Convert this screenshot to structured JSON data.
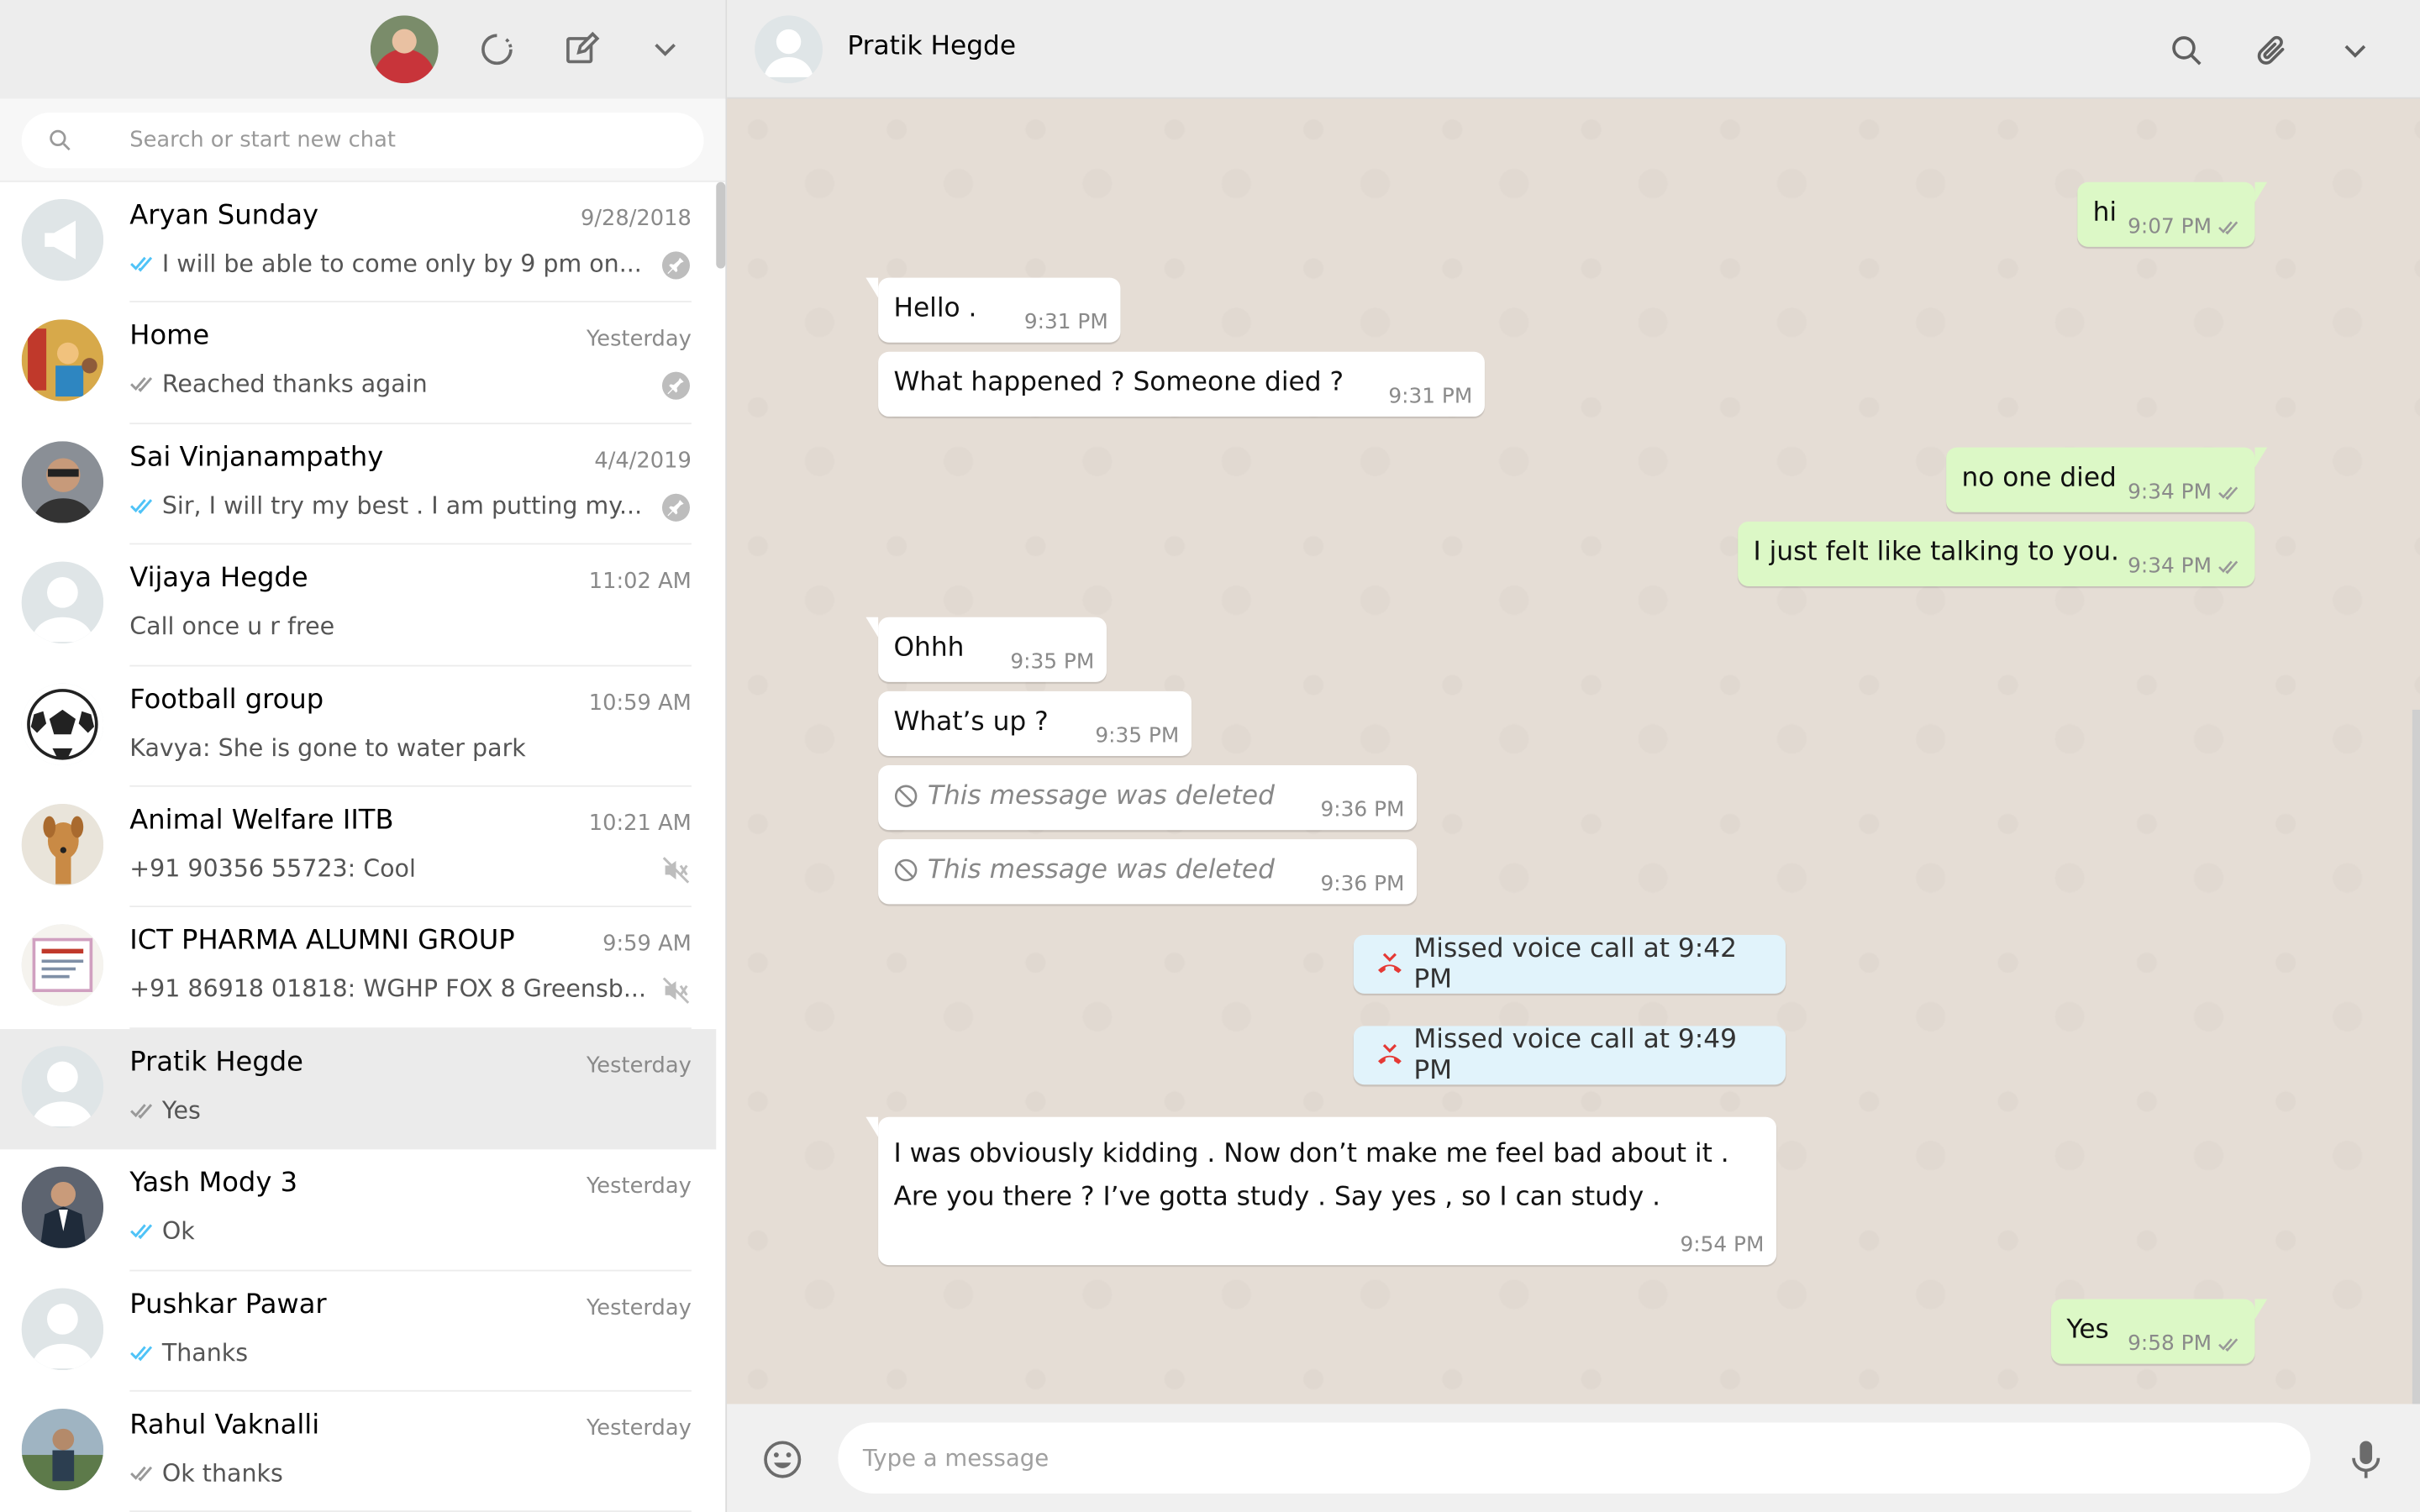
{
  "sidebar": {
    "search_placeholder": "Search or start new chat",
    "chats": [
      {
        "name": "Aryan Sunday",
        "time": "9/28/2018",
        "preview": "I will be able to come only by 9 pm on...",
        "tick": "blue",
        "status": "pin",
        "avatar": "megaphone"
      },
      {
        "name": "Home",
        "time": "Yesterday",
        "preview": "Reached thanks again",
        "tick": "grey",
        "status": "pin",
        "avatar": "photo-family"
      },
      {
        "name": "Sai Vinjanampathy",
        "time": "4/4/2019",
        "preview": "Sir, I will try my best . I am putting my...",
        "tick": "blue",
        "status": "pin",
        "avatar": "photo-man"
      },
      {
        "name": "Vijaya Hegde",
        "time": "11:02 AM",
        "preview": "Call once u r free",
        "tick": "",
        "status": "",
        "avatar": "default"
      },
      {
        "name": "Football group",
        "time": "10:59 AM",
        "preview": "Kavya: She is gone to water park",
        "tick": "",
        "status": "",
        "avatar": "football"
      },
      {
        "name": "Animal Welfare IITB",
        "time": "10:21 AM",
        "preview": "+91 90356 55723: Cool",
        "tick": "",
        "status": "muted",
        "avatar": "dog"
      },
      {
        "name": "ICT PHARMA ALUMNI GROUP",
        "time": "9:59 AM",
        "preview": "+91 86918 01818: WGHP FOX 8 Greensb...",
        "tick": "",
        "status": "muted",
        "avatar": "certificate"
      },
      {
        "name": "Pratik Hegde",
        "time": "Yesterday",
        "preview": "Yes",
        "tick": "grey",
        "status": "",
        "avatar": "default"
      },
      {
        "name": "Yash Mody 3",
        "time": "Yesterday",
        "preview": "Ok",
        "tick": "blue",
        "status": "",
        "avatar": "photo-suit"
      },
      {
        "name": "Pushkar Pawar",
        "time": "Yesterday",
        "preview": "Thanks",
        "tick": "blue",
        "status": "",
        "avatar": "default"
      },
      {
        "name": "Rahul Vaknalli",
        "time": "Yesterday",
        "preview": "Ok thanks",
        "tick": "grey",
        "status": "",
        "avatar": "photo-outdoor"
      }
    ]
  },
  "conversation": {
    "contact_name": "Pratik Hegde",
    "messages": [
      {
        "dir": "out",
        "text": "hi",
        "time": "9:07 PM"
      },
      {
        "dir": "in",
        "text": "Hello .",
        "time": "9:31 PM"
      },
      {
        "dir": "in",
        "text": "What happened ? Someone died ?",
        "time": "9:31 PM"
      },
      {
        "dir": "out",
        "text": "no one died",
        "time": "9:34 PM"
      },
      {
        "dir": "out",
        "text": "I just felt like talking to you.",
        "time": "9:34 PM"
      },
      {
        "dir": "in",
        "text": "Ohhh",
        "time": "9:35 PM"
      },
      {
        "dir": "in",
        "text": "What’s up ?",
        "time": "9:35 PM"
      },
      {
        "dir": "in",
        "text": "This message was deleted",
        "time": "9:36 PM"
      },
      {
        "dir": "in",
        "text": "This message was deleted",
        "time": "9:36 PM"
      },
      {
        "dir": "system",
        "text": "Missed voice call at 9:42 PM"
      },
      {
        "dir": "system",
        "text": "Missed voice call at 9:49 PM"
      },
      {
        "dir": "in",
        "line1": "I was obviously kidding . Now don’t make me feel bad about it .",
        "line2": "Are you there ? I’ve gotta study . Say yes , so I can study .",
        "time": "9:54 PM"
      },
      {
        "dir": "out",
        "text": "Yes",
        "time": "9:58 PM"
      }
    ]
  },
  "composer": {
    "placeholder": "Type a message"
  },
  "colors": {
    "outgoing_bubble": "#dcf8c6",
    "incoming_bubble": "#ffffff",
    "call_bubble": "#e1f3fb",
    "read_tick": "#4fc3f7",
    "missed_call": "#e53935"
  }
}
